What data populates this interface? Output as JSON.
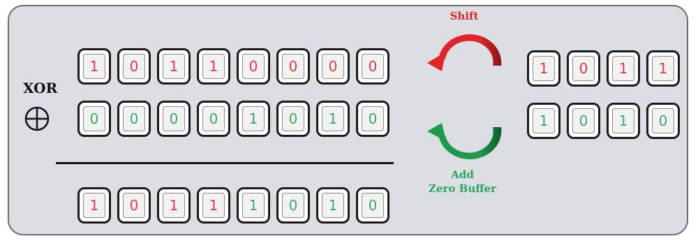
{
  "operator": {
    "label": "XOR",
    "symbol_icon": "circled-plus-icon"
  },
  "shift": {
    "label": "Shift",
    "color": "#d9252a"
  },
  "add": {
    "label_line1": "Add",
    "label_line2": "Zero Buffer",
    "color": "#2aa659"
  },
  "colors": {
    "red_bit": "#e63946",
    "green_bit": "#3aa86b"
  },
  "operand_a": [
    {
      "bit": "1",
      "color": "red"
    },
    {
      "bit": "0",
      "color": "red"
    },
    {
      "bit": "1",
      "color": "red"
    },
    {
      "bit": "1",
      "color": "red"
    },
    {
      "bit": "0",
      "color": "red"
    },
    {
      "bit": "0",
      "color": "red"
    },
    {
      "bit": "0",
      "color": "red"
    },
    {
      "bit": "0",
      "color": "red"
    }
  ],
  "operand_b": [
    {
      "bit": "0",
      "color": "green"
    },
    {
      "bit": "0",
      "color": "green"
    },
    {
      "bit": "0",
      "color": "green"
    },
    {
      "bit": "0",
      "color": "green"
    },
    {
      "bit": "1",
      "color": "green"
    },
    {
      "bit": "0",
      "color": "green"
    },
    {
      "bit": "1",
      "color": "green"
    },
    {
      "bit": "0",
      "color": "green"
    }
  ],
  "result": [
    {
      "bit": "1",
      "color": "red"
    },
    {
      "bit": "0",
      "color": "red"
    },
    {
      "bit": "1",
      "color": "red"
    },
    {
      "bit": "1",
      "color": "red"
    },
    {
      "bit": "1",
      "color": "green"
    },
    {
      "bit": "0",
      "color": "green"
    },
    {
      "bit": "1",
      "color": "green"
    },
    {
      "bit": "0",
      "color": "green"
    }
  ],
  "shifted_bits": [
    {
      "bit": "1",
      "color": "red"
    },
    {
      "bit": "0",
      "color": "red"
    },
    {
      "bit": "1",
      "color": "red"
    },
    {
      "bit": "1",
      "color": "red"
    }
  ],
  "buffer_bits": [
    {
      "bit": "1",
      "color": "green"
    },
    {
      "bit": "0",
      "color": "green"
    },
    {
      "bit": "1",
      "color": "green"
    },
    {
      "bit": "0",
      "color": "green"
    }
  ]
}
